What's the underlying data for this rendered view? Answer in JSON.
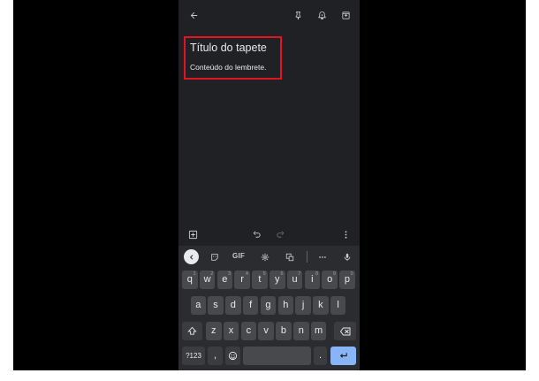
{
  "note": {
    "title": "Título do tapete",
    "body": "Conteúdo do lembrete."
  },
  "toolbar_icons": [
    "back-arrow-icon",
    "pin-icon",
    "reminder-bell-icon",
    "archive-icon"
  ],
  "edit_icons": [
    "add-box-icon",
    "undo-icon",
    "redo-icon",
    "more-vert-icon"
  ],
  "keyboard": {
    "suggestion_strip": {
      "gif_label": "GIF",
      "icons": [
        "collapse-icon",
        "sticker-icon",
        "settings-icon",
        "translate-icon",
        "more-icon",
        "mic-icon"
      ]
    },
    "row1": [
      {
        "k": "q",
        "h": "1"
      },
      {
        "k": "w",
        "h": "2"
      },
      {
        "k": "e",
        "h": "3"
      },
      {
        "k": "r",
        "h": "4"
      },
      {
        "k": "t",
        "h": "5"
      },
      {
        "k": "y",
        "h": "6"
      },
      {
        "k": "u",
        "h": "7"
      },
      {
        "k": "i",
        "h": "8"
      },
      {
        "k": "o",
        "h": "9"
      },
      {
        "k": "p",
        "h": "0"
      }
    ],
    "row2": [
      "a",
      "s",
      "d",
      "f",
      "g",
      "h",
      "j",
      "k",
      "l"
    ],
    "row3": [
      "z",
      "x",
      "c",
      "v",
      "b",
      "n",
      "m"
    ],
    "symbols_label": "?123",
    "comma_label": ",",
    "period_label": "."
  },
  "colors": {
    "background": "#202124",
    "keyboard": "#2b2c30",
    "key": "#48494d",
    "enter": "#8ab4f8",
    "highlight": "#e3141f"
  }
}
